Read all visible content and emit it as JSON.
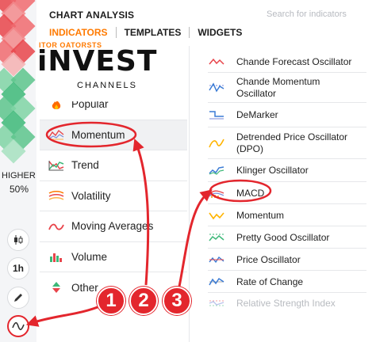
{
  "header": {
    "title": "CHART ANALYSIS",
    "search_placeholder": "Search for indicators",
    "tabs": [
      {
        "label": "INDICATORS",
        "active": true
      },
      {
        "label": "TEMPLATES",
        "active": false
      },
      {
        "label": "WIDGETS",
        "active": false
      }
    ]
  },
  "watermark": {
    "top": "ITOR OATORSTS",
    "main": "iNVEST",
    "sub": "CHANNELS"
  },
  "left_panel": {
    "higher_label": "HIGHER",
    "higher_percent": "50%",
    "timeframe": "1h"
  },
  "categories": [
    {
      "label": "Popular",
      "icon": "fire-icon",
      "active": false
    },
    {
      "label": "Momentum",
      "icon": "momentum-icon",
      "active": true
    },
    {
      "label": "Trend",
      "icon": "trend-icon",
      "active": false
    },
    {
      "label": "Volatility",
      "icon": "volatility-icon",
      "active": false
    },
    {
      "label": "Moving Averages",
      "icon": "moving-average-icon",
      "active": false
    },
    {
      "label": "Volume",
      "icon": "volume-icon",
      "active": false
    },
    {
      "label": "Other",
      "icon": "other-icon",
      "active": false
    }
  ],
  "indicators": [
    {
      "label": "Chande Forecast Oscillator",
      "icon": "chande-forecast-icon"
    },
    {
      "label": "Chande Momentum Oscillator",
      "icon": "chande-momentum-icon"
    },
    {
      "label": "DeMarker",
      "icon": "demarker-icon"
    },
    {
      "label": "Detrended Price Oscillator (DPO)",
      "icon": "dpo-icon"
    },
    {
      "label": "Klinger Oscillator",
      "icon": "klinger-icon"
    },
    {
      "label": "MACD",
      "icon": "macd-icon"
    },
    {
      "label": "Momentum",
      "icon": "momentum-indicator-icon"
    },
    {
      "label": "Pretty Good Oscillator",
      "icon": "pgo-icon"
    },
    {
      "label": "Price Oscillator",
      "icon": "price-oscillator-icon"
    },
    {
      "label": "Rate of Change",
      "icon": "rate-of-change-icon"
    },
    {
      "label": "Relative Strength Index",
      "icon": "rsi-icon"
    }
  ],
  "annotations": [
    "1",
    "2",
    "3"
  ],
  "colors": {
    "accent": "#ff7a00",
    "annotation_red": "#e3262d",
    "up_green": "#3cb878",
    "down_red": "#e8444a"
  }
}
